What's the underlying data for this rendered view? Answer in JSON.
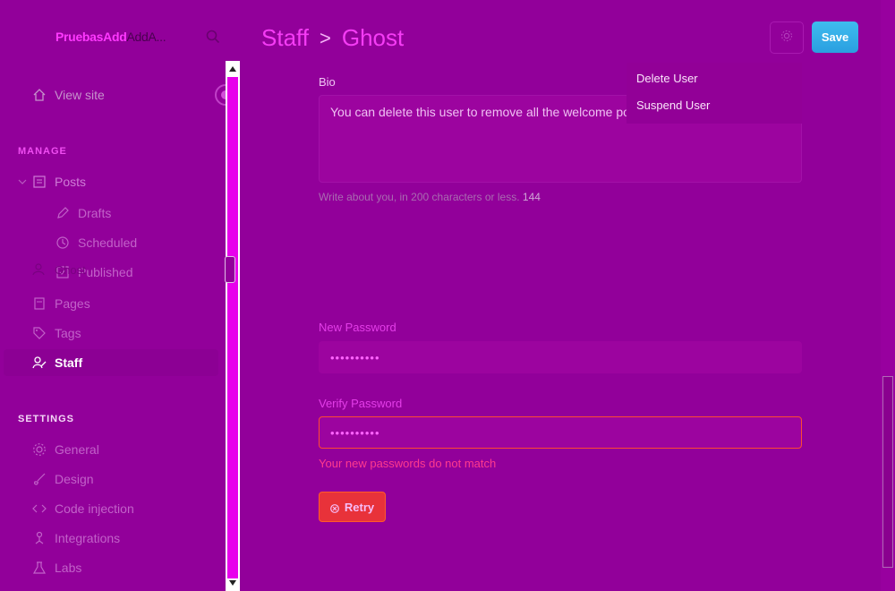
{
  "brand": {
    "part1": "PruebasAdd",
    "part2": "AddA..."
  },
  "sidebar": {
    "view_site": "View site",
    "manage_heading": "MANAGE",
    "posts": "Posts",
    "drafts": "Drafts",
    "scheduled": "Scheduled",
    "published": "Published",
    "ghost_overlay": "Ghost",
    "pages": "Pages",
    "tags": "Tags",
    "staff": "Staff",
    "settings_heading": "SETTINGS",
    "general": "General",
    "design": "Design",
    "code_injection": "Code injection",
    "integrations": "Integrations",
    "labs": "Labs"
  },
  "header": {
    "section": "Staff",
    "separator": ">",
    "user": "Ghost",
    "save_label": "Save"
  },
  "dropdown": {
    "items": [
      "Delete User",
      "Suspend User"
    ]
  },
  "form": {
    "bio_label": "Bio",
    "bio_value": "You can delete this user to remove all the welcome posts",
    "bio_hint_prefix": "Write about you, in 200 characters or less.",
    "bio_count": "144",
    "new_password_label": "New Password",
    "new_password_value": "••••••••••",
    "verify_password_label": "Verify Password",
    "verify_password_value": "••••••••••",
    "error_message": "Your new passwords do not match",
    "retry_label": "Retry"
  }
}
